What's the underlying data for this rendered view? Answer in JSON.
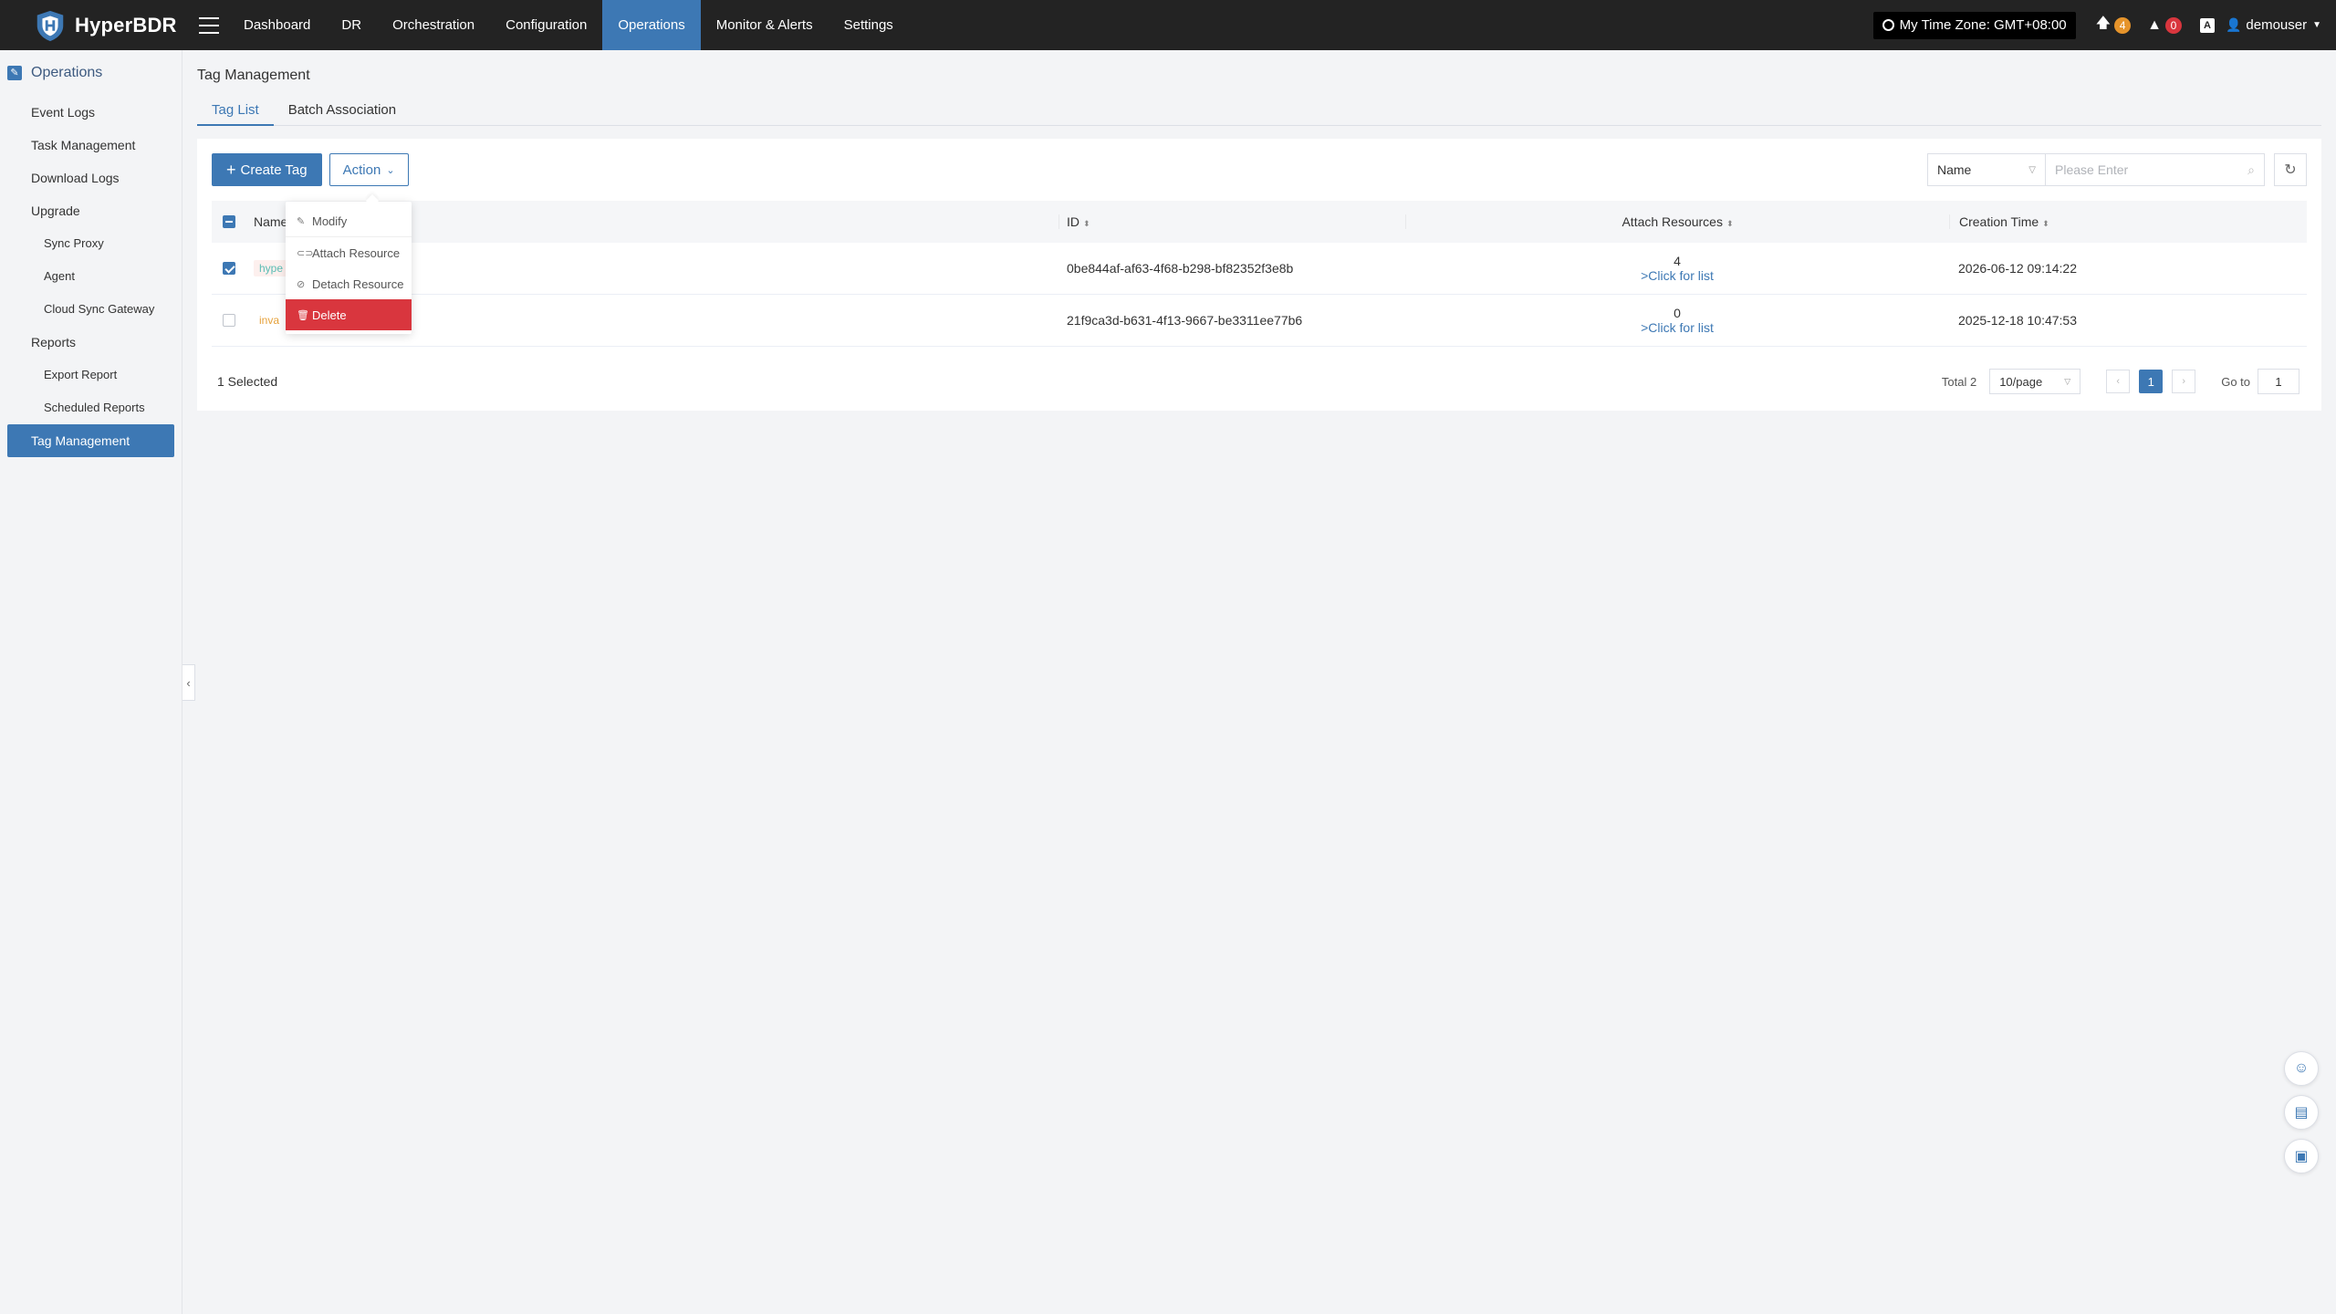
{
  "app": {
    "name": "HyperBDR"
  },
  "nav": [
    {
      "label": "Dashboard"
    },
    {
      "label": "DR"
    },
    {
      "label": "Orchestration"
    },
    {
      "label": "Configuration"
    },
    {
      "label": "Operations"
    },
    {
      "label": "Monitor & Alerts"
    },
    {
      "label": "Settings"
    }
  ],
  "topbar": {
    "timezone": "My Time Zone: GMT+08:00",
    "upgrade_count": "4",
    "alert_count": "0",
    "lang_icon": "A",
    "user": "demouser"
  },
  "sidebar": {
    "title": "Operations",
    "items": [
      {
        "label": "Event Logs"
      },
      {
        "label": "Task Management"
      },
      {
        "label": "Download Logs"
      },
      {
        "label": "Upgrade"
      },
      {
        "label": "Sync Proxy"
      },
      {
        "label": "Agent"
      },
      {
        "label": "Cloud Sync Gateway"
      },
      {
        "label": "Reports"
      },
      {
        "label": "Export Report"
      },
      {
        "label": "Scheduled Reports"
      },
      {
        "label": "Tag Management"
      }
    ]
  },
  "page": {
    "title": "Tag Management",
    "tabs": [
      {
        "label": "Tag List"
      },
      {
        "label": "Batch Association"
      }
    ]
  },
  "toolbar": {
    "create_label": "Create Tag",
    "action_label": "Action",
    "filter_field": "Name",
    "search_placeholder": "Please Enter"
  },
  "table": {
    "columns": [
      "Name",
      "ID",
      "Attach Resources",
      "Creation Time"
    ],
    "rows": [
      {
        "name": "hype",
        "id": "0be844af-af63-4f68-b298-bf82352f3e8b",
        "attach_count": "4",
        "attach_link": ">Click for list",
        "created": "2026-06-12 09:14:22",
        "checked": true
      },
      {
        "name": "inva",
        "id": "21f9ca3d-b631-4f13-9667-be3311ee77b6",
        "attach_count": "0",
        "attach_link": ">Click for list",
        "created": "2025-12-18 10:47:53",
        "checked": false
      }
    ]
  },
  "footer": {
    "selected": "1 Selected",
    "total": "Total 2",
    "page_size": "10/page",
    "current_page": "1",
    "goto_label": "Go to",
    "goto_value": "1"
  },
  "action_menu": [
    {
      "label": "Modify",
      "icon": "edit-icon"
    },
    {
      "label": "Attach Resource",
      "icon": "link-icon"
    },
    {
      "label": "Detach Resource",
      "icon": "unlink-icon"
    },
    {
      "label": "Delete",
      "icon": "trash-icon"
    }
  ],
  "colors": {
    "accent": "#3d78b4",
    "danger": "#d9363e",
    "topbar": "#232323"
  }
}
